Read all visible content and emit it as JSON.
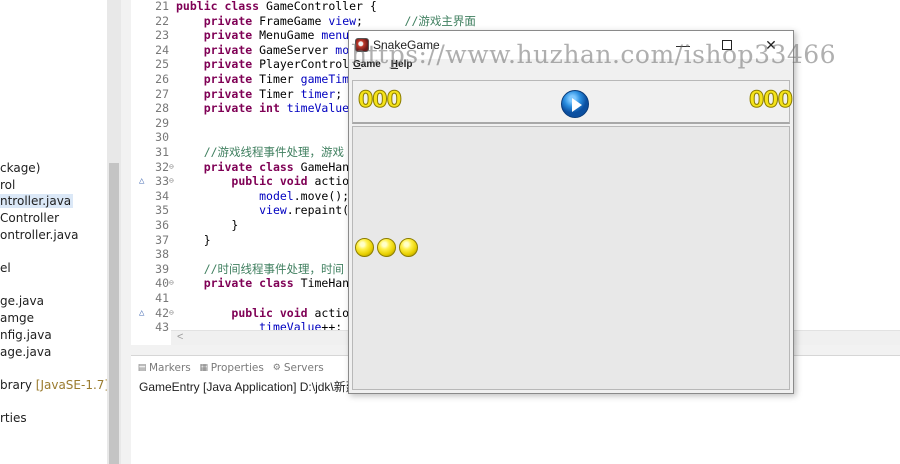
{
  "explorer": {
    "items": [
      {
        "label": "ckage)"
      },
      {
        "label": "rol"
      },
      {
        "label": "ntroller.java",
        "selected": true
      },
      {
        "label": "Controller"
      },
      {
        "label": "ontroller.java"
      },
      {
        "label": "el"
      },
      {
        "label": "ge.java"
      },
      {
        "label": "amge"
      },
      {
        "label": "nfig.java"
      },
      {
        "label": "age.java"
      },
      {
        "label": "brary",
        "extra": "[JavaSE-1.7]"
      },
      {
        "label": "rties"
      }
    ]
  },
  "editor": {
    "lines": [
      {
        "num": "21",
        "parts": [
          [
            "kw",
            "public class "
          ],
          [
            "",
            "GameController {"
          ]
        ]
      },
      {
        "num": "22",
        "parts": [
          [
            "",
            "    "
          ],
          [
            "kw",
            "private "
          ],
          [
            "",
            "FrameGame "
          ],
          [
            "fld",
            "view"
          ],
          [
            "",
            ";      "
          ],
          [
            "cmt",
            "//游戏主界面"
          ]
        ]
      },
      {
        "num": "23",
        "parts": [
          [
            "",
            "    "
          ],
          [
            "kw",
            "private "
          ],
          [
            "",
            "MenuGame "
          ],
          [
            "fld",
            "menu"
          ],
          [
            "",
            ";"
          ]
        ]
      },
      {
        "num": "24",
        "parts": [
          [
            "",
            "    "
          ],
          [
            "kw",
            "private "
          ],
          [
            "",
            "GameServer "
          ],
          [
            "fld",
            "mode"
          ]
        ]
      },
      {
        "num": "25",
        "parts": [
          [
            "",
            "    "
          ],
          [
            "kw",
            "private "
          ],
          [
            "",
            "PlayerControlle"
          ]
        ]
      },
      {
        "num": "26",
        "parts": [
          [
            "",
            "    "
          ],
          [
            "kw",
            "private "
          ],
          [
            "",
            "Timer "
          ],
          [
            "fld",
            "gameTimer"
          ]
        ]
      },
      {
        "num": "27",
        "parts": [
          [
            "",
            "    "
          ],
          [
            "kw",
            "private "
          ],
          [
            "",
            "Timer "
          ],
          [
            "fld",
            "timer"
          ],
          [
            "",
            ";"
          ]
        ]
      },
      {
        "num": "28",
        "parts": [
          [
            "",
            "    "
          ],
          [
            "kw",
            "private int "
          ],
          [
            "fld",
            "timeValue"
          ],
          [
            "",
            " ="
          ]
        ]
      },
      {
        "num": "29",
        "parts": []
      },
      {
        "num": "30",
        "parts": []
      },
      {
        "num": "31",
        "parts": [
          [
            "",
            "    "
          ],
          [
            "cmt",
            "//游戏线程事件处理，游戏"
          ]
        ]
      },
      {
        "num": "32",
        "fold": true,
        "parts": [
          [
            "",
            "    "
          ],
          [
            "kw",
            "private class "
          ],
          [
            "",
            "GameHandl"
          ]
        ]
      },
      {
        "num": "33",
        "fold": true,
        "marker": true,
        "parts": [
          [
            "",
            "        "
          ],
          [
            "kw",
            "public void "
          ],
          [
            "",
            "actionP"
          ]
        ]
      },
      {
        "num": "34",
        "parts": [
          [
            "",
            "            "
          ],
          [
            "fld",
            "model"
          ],
          [
            "",
            ".move();"
          ]
        ]
      },
      {
        "num": "35",
        "parts": [
          [
            "",
            "            "
          ],
          [
            "fld",
            "view"
          ],
          [
            "",
            ".repaint()"
          ]
        ]
      },
      {
        "num": "36",
        "parts": [
          [
            "",
            "        }"
          ]
        ]
      },
      {
        "num": "37",
        "parts": [
          [
            "",
            "    }"
          ]
        ]
      },
      {
        "num": "38",
        "parts": []
      },
      {
        "num": "39",
        "parts": [
          [
            "",
            "    "
          ],
          [
            "cmt",
            "//时间线程事件处理，时间"
          ]
        ]
      },
      {
        "num": "40",
        "fold": true,
        "parts": [
          [
            "",
            "    "
          ],
          [
            "kw",
            "private class "
          ],
          [
            "",
            "TimeHandl"
          ]
        ]
      },
      {
        "num": "41",
        "parts": []
      },
      {
        "num": "42",
        "fold": true,
        "marker": true,
        "parts": [
          [
            "",
            "        "
          ],
          [
            "kw",
            "public void "
          ],
          [
            "",
            "actionP"
          ]
        ]
      },
      {
        "num": "43",
        "parts": [
          [
            "",
            "            "
          ],
          [
            "fld",
            "timeValue"
          ],
          [
            "",
            "++;"
          ]
        ]
      }
    ]
  },
  "bottom_panel": {
    "tabs": [
      {
        "icon": "markers-icon",
        "label": "Markers"
      },
      {
        "icon": "properties-icon",
        "label": "Properties"
      },
      {
        "icon": "servers-icon",
        "label": "Servers"
      }
    ],
    "console_text": "GameEntry [Java Application] D:\\jdk\\新建"
  },
  "game_window": {
    "title": "SnakeGame",
    "watermark": "https://www.huzhan.com/ishop33466",
    "menu": [
      {
        "label": "Game",
        "mnemonic": "G",
        "rest": "ame"
      },
      {
        "label": "Help",
        "mnemonic": "H",
        "rest": "elp"
      }
    ],
    "controls": {
      "minimize": "—",
      "close": "✕"
    },
    "left_score": "000",
    "right_score": "000",
    "snake_segments": 3
  },
  "colors": {
    "keyword": "#7f0055",
    "field": "#0000c0",
    "comment": "#3f7f5f",
    "score_yellow": "#f5e31a",
    "play_blue": "#2a8ee0"
  }
}
